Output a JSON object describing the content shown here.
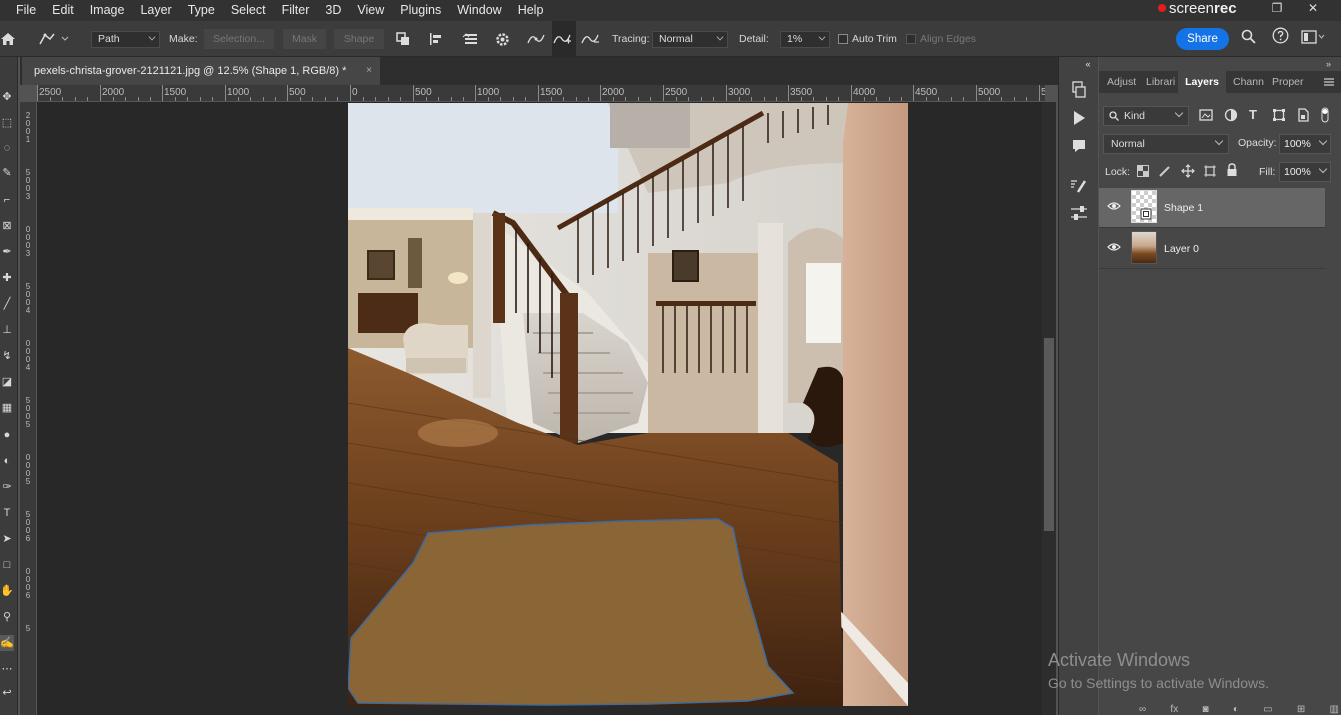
{
  "menu": {
    "items": [
      "File",
      "Edit",
      "Image",
      "Layer",
      "Type",
      "Select",
      "Filter",
      "3D",
      "View",
      "Plugins",
      "Window",
      "Help"
    ]
  },
  "overlay": {
    "brand_a": "screen",
    "brand_b": "rec"
  },
  "options": {
    "mode": "Path",
    "make_label": "Make:",
    "selection": "Selection...",
    "mask": "Mask",
    "shape": "Shape",
    "tracing_label": "Tracing:",
    "tracing_value": "Normal",
    "detail_label": "Detail:",
    "detail_value": "1%",
    "auto_trim": "Auto Trim",
    "align_edges": "Align Edges",
    "share": "Share"
  },
  "document": {
    "tab_title": "pexels-christa-grover-2121121.jpg @ 12.5% (Shape 1, RGB/8) *",
    "close": "×"
  },
  "ruler": {
    "h_labels": [
      "2500",
      "2000",
      "1500",
      "1000",
      "500",
      "0",
      "500",
      "1000",
      "1500",
      "2000",
      "2500",
      "3000",
      "3500",
      "4000",
      "4500",
      "5000",
      "5"
    ],
    "v_labels": [
      "2",
      "0",
      "0",
      "1",
      "5",
      "0",
      "0",
      "3",
      "0",
      "0",
      "0",
      "3",
      "5",
      "0",
      "0",
      "4",
      "0",
      "0",
      "0",
      "4",
      "5",
      "0",
      "0",
      "5",
      "0",
      "0",
      "0",
      "5",
      "5",
      "0",
      "0",
      "6",
      "0",
      "0",
      "0",
      "6",
      "5"
    ]
  },
  "panel": {
    "tabs": [
      "Adjust",
      "Librari",
      "Layers",
      "Chann",
      "Proper"
    ],
    "active_tab": "Layers",
    "filter_kind": "Kind",
    "blend_mode": "Normal",
    "opacity_label": "Opacity:",
    "opacity_value": "100%",
    "lock_label": "Lock:",
    "fill_label": "Fill:",
    "fill_value": "100%",
    "layers": [
      {
        "name": "Shape 1",
        "selected": true
      },
      {
        "name": "Layer 0",
        "selected": false
      }
    ]
  },
  "watermark": {
    "line1": "Activate Windows",
    "line2": "Go to Settings to activate Windows."
  },
  "colors": {
    "accent": "#1473e6",
    "shape_fill": "#8a6637",
    "shape_stroke": "#3d6aa0"
  }
}
